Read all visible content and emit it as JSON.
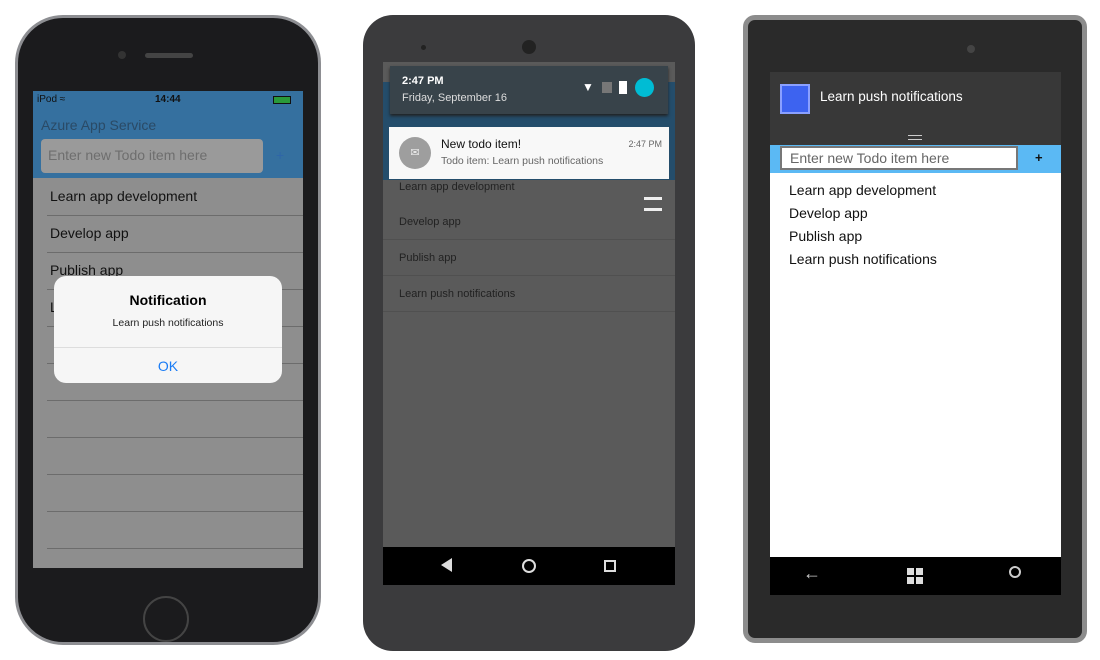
{
  "ios": {
    "carrier": "iPod",
    "time": "14:44",
    "title": "Azure App Service",
    "input_placeholder": "Enter new Todo item here",
    "add_label": "+",
    "items": [
      "Learn app development",
      "Develop app",
      "Publish app",
      "L"
    ],
    "alert": {
      "title": "Notification",
      "message": "Learn push notifications",
      "ok": "OK"
    }
  },
  "android": {
    "time": "2:47 PM",
    "date": "Friday, September 16",
    "notification": {
      "title": "New todo item!",
      "time": "2:47 PM",
      "text": "Todo item: Learn push notifications"
    },
    "items": [
      "Learn app development",
      "Develop app",
      "Publish app",
      "Learn push notifications"
    ]
  },
  "windows": {
    "toast": "Learn push notifications",
    "input_placeholder": "Enter new Todo item here",
    "add_label": "+",
    "items": [
      "Learn app development",
      "Develop app",
      "Publish app",
      "Learn push notifications"
    ]
  },
  "colors": {
    "ios_bar": "#35709f",
    "ios_link": "#1a7cf5",
    "android_accent": "#00bcd4",
    "windows_accent": "#5bb9f4"
  }
}
